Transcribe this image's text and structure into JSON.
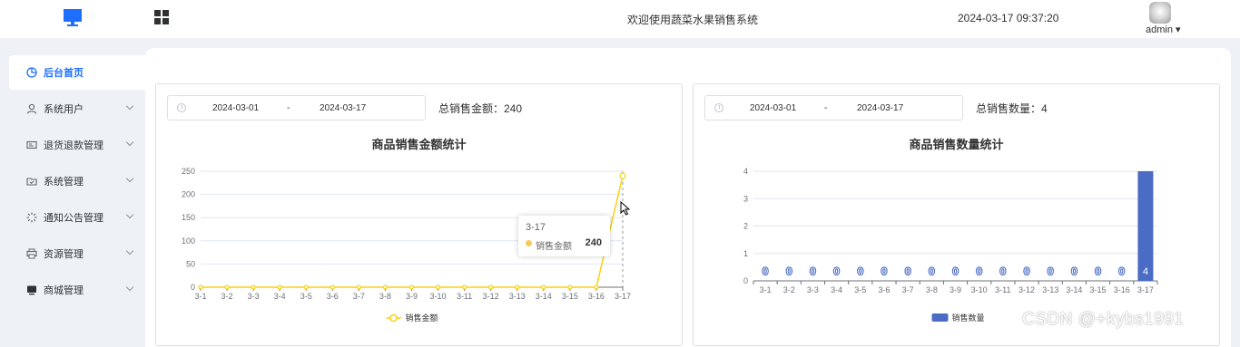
{
  "header": {
    "welcome": "欢迎使用蔬菜水果销售系统",
    "datetime": "2024-03-17 09:37:20",
    "user": "admin ▾"
  },
  "sidebar": {
    "items": [
      {
        "label": "后台首页",
        "icon": "pie-chart-icon"
      },
      {
        "label": "系统用户",
        "icon": "user-icon"
      },
      {
        "label": "退货退款管理",
        "icon": "credit-card-icon"
      },
      {
        "label": "系统管理",
        "icon": "folder-check-icon"
      },
      {
        "label": "通知公告管理",
        "icon": "loading-icon"
      },
      {
        "label": "资源管理",
        "icon": "printer-icon"
      },
      {
        "label": "商城管理",
        "icon": "monitor-icon"
      }
    ]
  },
  "left_card": {
    "start_date": "2024-03-01",
    "separator": "-",
    "end_date": "2024-03-17",
    "total_text": "总销售金额：240",
    "tooltip": {
      "category": "3-17",
      "name": "销售金额",
      "value": "240"
    }
  },
  "right_card": {
    "start_date": "2024-03-01",
    "separator": "-",
    "end_date": "2024-03-17",
    "total_text": "总销售数量：4"
  },
  "watermark": "CSDN @+kybs1991",
  "colors": {
    "accent": "#1e6fff",
    "line": "#fad00e",
    "bar": "#4a6cc5"
  },
  "chart_data": [
    {
      "type": "line",
      "title": "商品销售金额统计",
      "categories": [
        "3-1",
        "3-2",
        "3-3",
        "3-4",
        "3-5",
        "3-6",
        "3-7",
        "3-8",
        "3-9",
        "3-10",
        "3-11",
        "3-12",
        "3-13",
        "3-14",
        "3-15",
        "3-16",
        "3-17"
      ],
      "series": [
        {
          "name": "销售金额",
          "values": [
            0,
            0,
            0,
            0,
            0,
            0,
            0,
            0,
            0,
            0,
            0,
            0,
            0,
            0,
            0,
            0,
            240
          ]
        }
      ],
      "yticks": [
        "0",
        "50",
        "100",
        "150",
        "200",
        "250"
      ],
      "ylim": [
        0,
        250
      ],
      "legend": "bottom-center",
      "grid": true
    },
    {
      "type": "bar",
      "title": "商品销售数量统计",
      "categories": [
        "3-1",
        "3-2",
        "3-3",
        "3-4",
        "3-5",
        "3-6",
        "3-7",
        "3-8",
        "3-9",
        "3-10",
        "3-11",
        "3-12",
        "3-13",
        "3-14",
        "3-15",
        "3-16",
        "3-17"
      ],
      "series": [
        {
          "name": "销售数量",
          "values": [
            0,
            0,
            0,
            0,
            0,
            0,
            0,
            0,
            0,
            0,
            0,
            0,
            0,
            0,
            0,
            0,
            4
          ]
        }
      ],
      "yticks": [
        "0",
        "1",
        "2",
        "3",
        "4"
      ],
      "ylim": [
        0,
        4
      ],
      "legend": "bottom-center",
      "grid": true
    }
  ]
}
